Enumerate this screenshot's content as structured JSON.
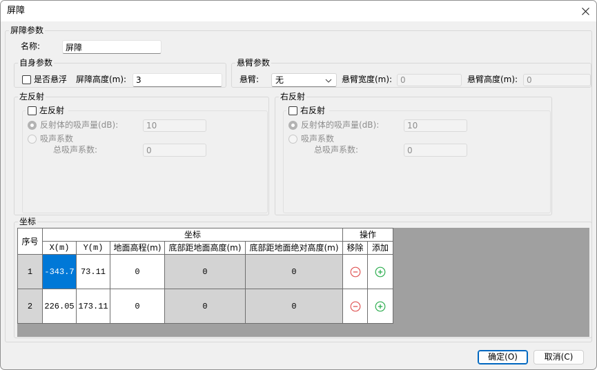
{
  "window": {
    "title": "屏障"
  },
  "barrier_params": {
    "group_label": "屏障参数",
    "name_label": "名称:",
    "name_value": "屏障"
  },
  "self_params": {
    "group_label": "自身参数",
    "floating_label": "是否悬浮",
    "floating_checked": false,
    "height_label": "屏障高度(m):",
    "height_value": "3"
  },
  "cantilever_params": {
    "group_label": "悬臂参数",
    "cantilever_label": "悬臂:",
    "cantilever_selected": "无",
    "width_label": "悬臂宽度(m):",
    "width_value": "0",
    "height_label": "悬臂高度(m):",
    "height_value": "0"
  },
  "left_reflection": {
    "group_label": "左反射",
    "enable_label": "左反射",
    "enabled": false,
    "absorption_label": "反射体的吸声量(dB):",
    "absorption_value": "10",
    "absorption_mode_selected": true,
    "coefficient_label": "吸声系数",
    "coefficient_mode_selected": false,
    "total_coefficient_label": "总吸声系数:",
    "total_coefficient_value": "0"
  },
  "right_reflection": {
    "group_label": "右反射",
    "enable_label": "右反射",
    "enabled": false,
    "absorption_label": "反射体的吸声量(dB):",
    "absorption_value": "10",
    "absorption_mode_selected": true,
    "coefficient_label": "吸声系数",
    "coefficient_mode_selected": false,
    "total_coefficient_label": "总吸声系数:",
    "total_coefficient_value": "0"
  },
  "coordinates": {
    "group_label": "坐标",
    "headers": {
      "index": "序号",
      "coord_group": "坐标",
      "x": "X(m)",
      "y": "Y(m)",
      "ground_elevation": "地面高程(m)",
      "bottom_height": "底部距地面高度(m)",
      "bottom_abs_height": "底部距地面绝对高度(m)",
      "ops_group": "操作",
      "remove": "移除",
      "add": "添加"
    },
    "rows": [
      {
        "index": "1",
        "x": "-343.7",
        "y": "73.11",
        "ground_elevation": "0",
        "bottom_height": "0",
        "bottom_abs_height": "0"
      },
      {
        "index": "2",
        "x": "226.05",
        "y": "173.11",
        "ground_elevation": "0",
        "bottom_height": "0",
        "bottom_abs_height": "0"
      }
    ]
  },
  "footer": {
    "ok_label": "确定(O)",
    "cancel_label": "取消(C)"
  },
  "icons": {
    "close": "close-icon",
    "dropdown": "chevron-down-icon",
    "remove_row": "minus-circle-icon",
    "add_row": "plus-circle-icon"
  },
  "colors": {
    "selection": "#0078d7",
    "grid_background": "#a0a0a0",
    "remove_icon": "#e05656",
    "add_icon": "#2eae50",
    "default_button_border": "#0067c0",
    "dialog_background": "#f0f0f0"
  }
}
